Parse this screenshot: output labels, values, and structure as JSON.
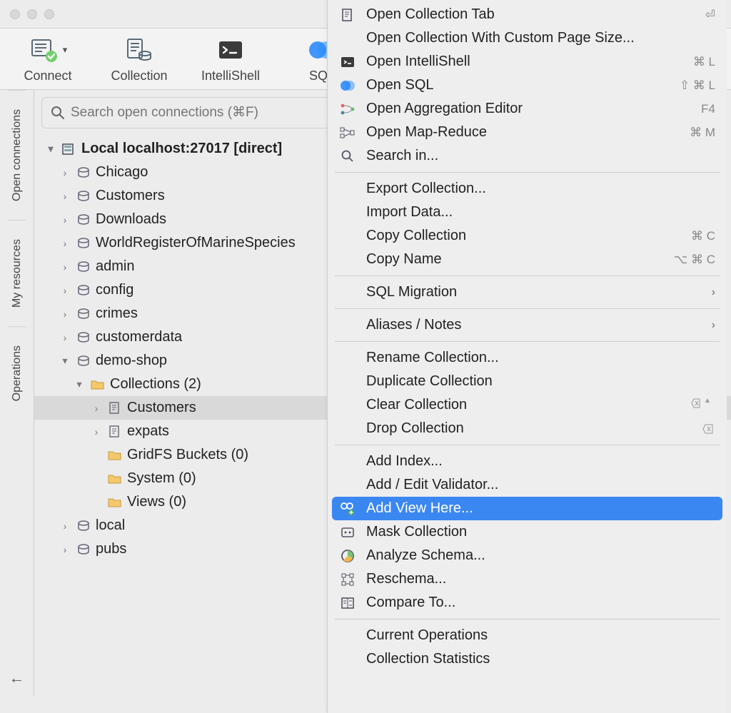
{
  "toolbar": {
    "connect": "Connect",
    "collection": "Collection",
    "intellishell": "IntelliShell",
    "sql": "SQL"
  },
  "search": {
    "placeholder": "Search open connections (⌘F)"
  },
  "side_tabs": {
    "open_connections": "Open connections",
    "my_resources": "My resources",
    "operations": "Operations"
  },
  "connection": {
    "label": "Local localhost:27017 [direct]"
  },
  "tree": {
    "dbs": [
      "Chicago",
      "Customers",
      "Downloads",
      "WorldRegisterOfMarineSpecies",
      "admin",
      "config",
      "crimes",
      "customerdata"
    ],
    "demo_shop": "demo-shop",
    "collections_folder": "Collections (2)",
    "coll_customers": "Customers",
    "coll_expats": "expats",
    "gridfs": "GridFS Buckets (0)",
    "system": "System (0)",
    "views": "Views (0)",
    "tail": [
      "local",
      "pubs"
    ]
  },
  "ctx": {
    "open_tab": "Open Collection Tab",
    "open_custom": "Open Collection With Custom Page Size...",
    "open_intellishell": "Open IntelliShell",
    "open_sql": "Open SQL",
    "open_agg": "Open Aggregation Editor",
    "open_mapreduce": "Open Map-Reduce",
    "search_in": "Search in...",
    "export": "Export Collection...",
    "import": "Import Data...",
    "copy_coll": "Copy Collection",
    "copy_name": "Copy Name",
    "sql_migration": "SQL Migration",
    "aliases": "Aliases / Notes",
    "rename": "Rename Collection...",
    "duplicate": "Duplicate Collection",
    "clear": "Clear Collection",
    "drop": "Drop Collection",
    "add_index": "Add Index...",
    "add_validator": "Add / Edit Validator...",
    "add_view": "Add View Here...",
    "mask": "Mask Collection",
    "analyze": "Analyze Schema...",
    "reschema": "Reschema...",
    "compare": "Compare To...",
    "current_ops": "Current Operations",
    "coll_stats": "Collection Statistics"
  },
  "kbd": {
    "enter": "⏎",
    "cmdL": "⌘ L",
    "scmdL": "⇧ ⌘ L",
    "f4": "F4",
    "cmdM": "⌘ M",
    "cmdC": "⌘ C",
    "ocmdC": "⌥ ⌘ C"
  }
}
